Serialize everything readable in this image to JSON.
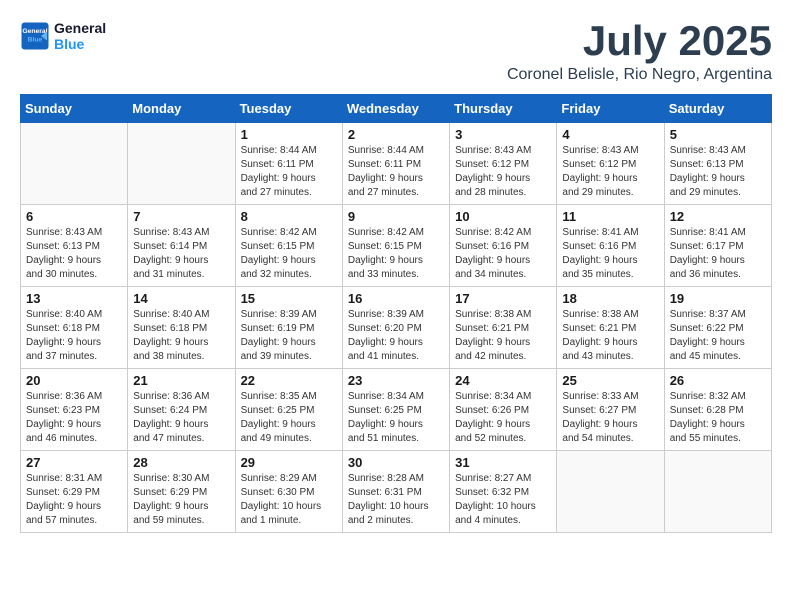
{
  "logo": {
    "line1": "General",
    "line2": "Blue"
  },
  "title": "July 2025",
  "subtitle": "Coronel Belisle, Rio Negro, Argentina",
  "headers": [
    "Sunday",
    "Monday",
    "Tuesday",
    "Wednesday",
    "Thursday",
    "Friday",
    "Saturday"
  ],
  "weeks": [
    [
      {
        "day": "",
        "info": ""
      },
      {
        "day": "",
        "info": ""
      },
      {
        "day": "1",
        "info": "Sunrise: 8:44 AM\nSunset: 6:11 PM\nDaylight: 9 hours\nand 27 minutes."
      },
      {
        "day": "2",
        "info": "Sunrise: 8:44 AM\nSunset: 6:11 PM\nDaylight: 9 hours\nand 27 minutes."
      },
      {
        "day": "3",
        "info": "Sunrise: 8:43 AM\nSunset: 6:12 PM\nDaylight: 9 hours\nand 28 minutes."
      },
      {
        "day": "4",
        "info": "Sunrise: 8:43 AM\nSunset: 6:12 PM\nDaylight: 9 hours\nand 29 minutes."
      },
      {
        "day": "5",
        "info": "Sunrise: 8:43 AM\nSunset: 6:13 PM\nDaylight: 9 hours\nand 29 minutes."
      }
    ],
    [
      {
        "day": "6",
        "info": "Sunrise: 8:43 AM\nSunset: 6:13 PM\nDaylight: 9 hours\nand 30 minutes."
      },
      {
        "day": "7",
        "info": "Sunrise: 8:43 AM\nSunset: 6:14 PM\nDaylight: 9 hours\nand 31 minutes."
      },
      {
        "day": "8",
        "info": "Sunrise: 8:42 AM\nSunset: 6:15 PM\nDaylight: 9 hours\nand 32 minutes."
      },
      {
        "day": "9",
        "info": "Sunrise: 8:42 AM\nSunset: 6:15 PM\nDaylight: 9 hours\nand 33 minutes."
      },
      {
        "day": "10",
        "info": "Sunrise: 8:42 AM\nSunset: 6:16 PM\nDaylight: 9 hours\nand 34 minutes."
      },
      {
        "day": "11",
        "info": "Sunrise: 8:41 AM\nSunset: 6:16 PM\nDaylight: 9 hours\nand 35 minutes."
      },
      {
        "day": "12",
        "info": "Sunrise: 8:41 AM\nSunset: 6:17 PM\nDaylight: 9 hours\nand 36 minutes."
      }
    ],
    [
      {
        "day": "13",
        "info": "Sunrise: 8:40 AM\nSunset: 6:18 PM\nDaylight: 9 hours\nand 37 minutes."
      },
      {
        "day": "14",
        "info": "Sunrise: 8:40 AM\nSunset: 6:18 PM\nDaylight: 9 hours\nand 38 minutes."
      },
      {
        "day": "15",
        "info": "Sunrise: 8:39 AM\nSunset: 6:19 PM\nDaylight: 9 hours\nand 39 minutes."
      },
      {
        "day": "16",
        "info": "Sunrise: 8:39 AM\nSunset: 6:20 PM\nDaylight: 9 hours\nand 41 minutes."
      },
      {
        "day": "17",
        "info": "Sunrise: 8:38 AM\nSunset: 6:21 PM\nDaylight: 9 hours\nand 42 minutes."
      },
      {
        "day": "18",
        "info": "Sunrise: 8:38 AM\nSunset: 6:21 PM\nDaylight: 9 hours\nand 43 minutes."
      },
      {
        "day": "19",
        "info": "Sunrise: 8:37 AM\nSunset: 6:22 PM\nDaylight: 9 hours\nand 45 minutes."
      }
    ],
    [
      {
        "day": "20",
        "info": "Sunrise: 8:36 AM\nSunset: 6:23 PM\nDaylight: 9 hours\nand 46 minutes."
      },
      {
        "day": "21",
        "info": "Sunrise: 8:36 AM\nSunset: 6:24 PM\nDaylight: 9 hours\nand 47 minutes."
      },
      {
        "day": "22",
        "info": "Sunrise: 8:35 AM\nSunset: 6:25 PM\nDaylight: 9 hours\nand 49 minutes."
      },
      {
        "day": "23",
        "info": "Sunrise: 8:34 AM\nSunset: 6:25 PM\nDaylight: 9 hours\nand 51 minutes."
      },
      {
        "day": "24",
        "info": "Sunrise: 8:34 AM\nSunset: 6:26 PM\nDaylight: 9 hours\nand 52 minutes."
      },
      {
        "day": "25",
        "info": "Sunrise: 8:33 AM\nSunset: 6:27 PM\nDaylight: 9 hours\nand 54 minutes."
      },
      {
        "day": "26",
        "info": "Sunrise: 8:32 AM\nSunset: 6:28 PM\nDaylight: 9 hours\nand 55 minutes."
      }
    ],
    [
      {
        "day": "27",
        "info": "Sunrise: 8:31 AM\nSunset: 6:29 PM\nDaylight: 9 hours\nand 57 minutes."
      },
      {
        "day": "28",
        "info": "Sunrise: 8:30 AM\nSunset: 6:29 PM\nDaylight: 9 hours\nand 59 minutes."
      },
      {
        "day": "29",
        "info": "Sunrise: 8:29 AM\nSunset: 6:30 PM\nDaylight: 10 hours\nand 1 minute."
      },
      {
        "day": "30",
        "info": "Sunrise: 8:28 AM\nSunset: 6:31 PM\nDaylight: 10 hours\nand 2 minutes."
      },
      {
        "day": "31",
        "info": "Sunrise: 8:27 AM\nSunset: 6:32 PM\nDaylight: 10 hours\nand 4 minutes."
      },
      {
        "day": "",
        "info": ""
      },
      {
        "day": "",
        "info": ""
      }
    ]
  ]
}
